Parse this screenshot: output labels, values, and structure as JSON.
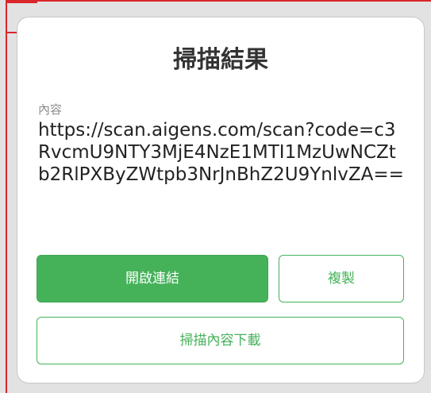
{
  "dialog": {
    "title": "掃描結果",
    "content_label": "內容",
    "content_value": "https://scan.aigens.com/scan?code=c3RvcmU9NTY3MjE4NzE1MTI1MzUwNCZtb2RlPXByZWtpb3NrJnBhZ2U9YnlvZA==",
    "buttons": {
      "open_link": "開啟連結",
      "copy": "複製",
      "download": "掃描內容下載"
    }
  },
  "colors": {
    "accent": "#45b25a",
    "background": "#e2e2e2",
    "dialog": "#ffffff",
    "edge_marker": "#d9262b"
  }
}
